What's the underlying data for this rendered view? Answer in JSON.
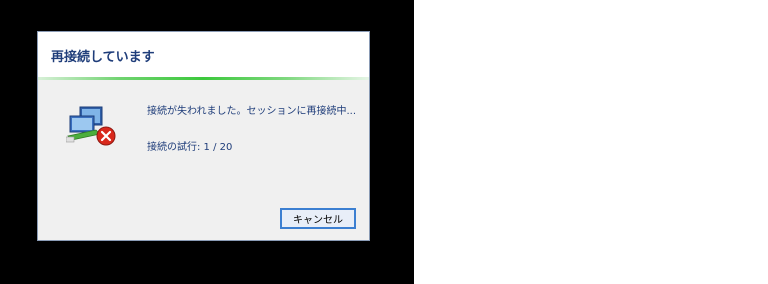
{
  "dialog": {
    "title": "再接続しています",
    "message": "接続が失われました。セッションに再接続中...",
    "attempt_label": "接続の試行: 1 / 20",
    "cancel_label": "キャンセル",
    "status_icon": "network-disconnected-icon",
    "error_icon": "error-x-icon",
    "accent_color": "#1f3d7a",
    "progress_color": "#3cc83c",
    "error_color": "#d9281c"
  }
}
